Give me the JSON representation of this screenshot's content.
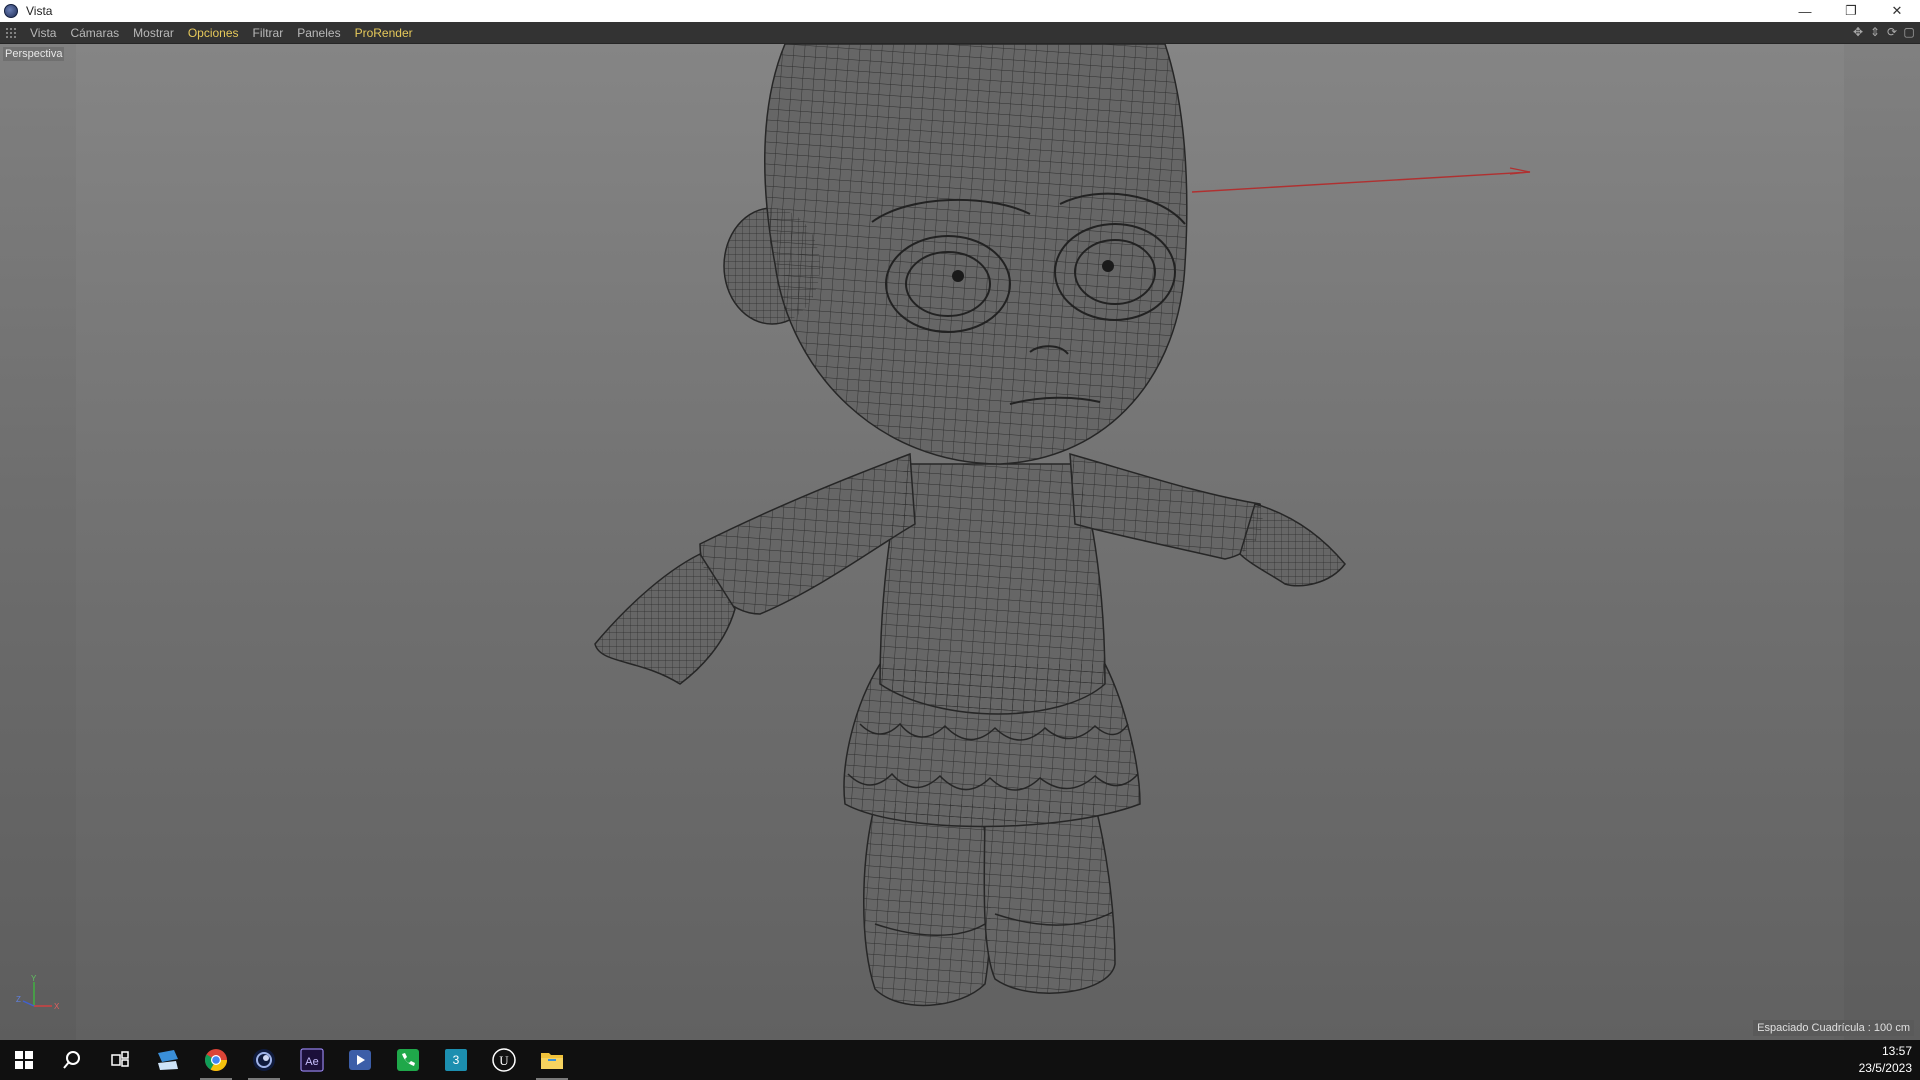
{
  "window": {
    "title": "Vista"
  },
  "menu": {
    "items": [
      {
        "label": "Vista",
        "highlight": false
      },
      {
        "label": "Cámaras",
        "highlight": false
      },
      {
        "label": "Mostrar",
        "highlight": false
      },
      {
        "label": "Opciones",
        "highlight": true
      },
      {
        "label": "Filtrar",
        "highlight": false
      },
      {
        "label": "Paneles",
        "highlight": false
      },
      {
        "label": "ProRender",
        "highlight": true
      }
    ]
  },
  "viewport": {
    "label": "Perspectiva",
    "grid_spacing": "Espaciado Cuadrícula : 100 cm",
    "axis": {
      "y": "Y",
      "z": "Z",
      "x": "X"
    }
  },
  "taskbar": {
    "icons": [
      "windows-start-icon",
      "search-icon",
      "task-view-icon",
      "file-transfer-icon",
      "chrome-icon",
      "cinema4d-icon",
      "after-effects-icon",
      "media-player-icon",
      "phone-app-icon",
      "3dsmax-icon",
      "unreal-engine-icon",
      "file-explorer-icon"
    ],
    "icon_labels": {
      "after_effects": "Ae",
      "max": "3",
      "unreal": "U"
    },
    "clock": {
      "time": "13:57",
      "date": "23/5/2023"
    }
  },
  "colors": {
    "highlight_menu": "#e6c95a",
    "viewport_top": "#858585",
    "viewport_bottom": "#616161",
    "axis_x": "#d04040",
    "axis_y": "#40b040",
    "axis_z": "#4060d0"
  }
}
